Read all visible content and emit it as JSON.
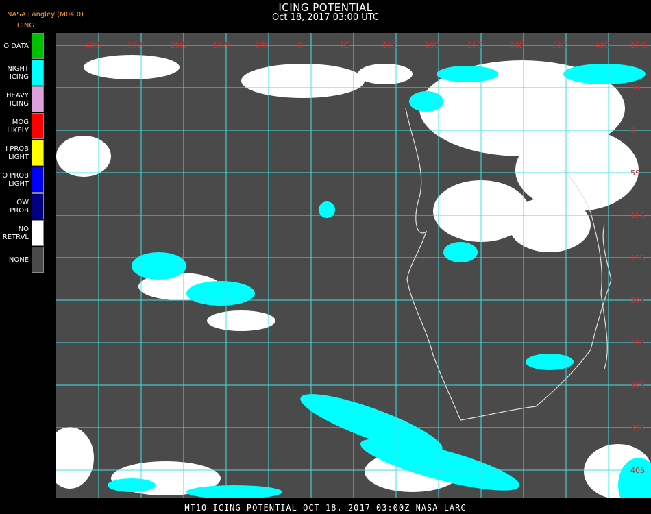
{
  "header": {
    "title": "ICING POTENTIAL",
    "subtitle": "Oct 18, 2017 03:00 UTC",
    "provider": "NASA Langley (M04.0)"
  },
  "legend": {
    "title": "ICING",
    "items": [
      {
        "lines": [
          "O DATA"
        ],
        "color": "#00c000"
      },
      {
        "lines": [
          "NIGHT",
          "ICING"
        ],
        "color": "#00ffff"
      },
      {
        "lines": [
          "HEAVY",
          "ICING"
        ],
        "color": "#dda0dd"
      },
      {
        "lines": [
          "MOG",
          "LIKELY"
        ],
        "color": "#ff0000"
      },
      {
        "lines": [
          "I PROB",
          "LIGHT"
        ],
        "color": "#ffff00"
      },
      {
        "lines": [
          "O PROB",
          "LIGHT"
        ],
        "color": "#0000ff"
      },
      {
        "lines": [
          "LOW",
          "PROB"
        ],
        "color": "#000080"
      },
      {
        "lines": [
          "NO",
          "RETRVL"
        ],
        "color": "#ffffff"
      },
      {
        "lines": [
          "NONE"
        ],
        "color": "#4a4a4a"
      }
    ]
  },
  "map": {
    "background": "#4a4a4a",
    "grid_color": "#40e0e8",
    "label_color": "#c03030",
    "coast_color": "#e0e0e0",
    "lon_labels": [
      "40W",
      "30W",
      "20W",
      "10W",
      "5W",
      "0",
      "5E",
      "10E",
      "20E",
      "25E",
      "30E",
      "35E",
      "40E"
    ],
    "lat_labels": [
      "15N",
      "5N",
      "0",
      "5S",
      "10S",
      "15S",
      "20S",
      "25S",
      "30S",
      "35S",
      "40S",
      "45S"
    ]
  },
  "footer": "MT10   ICING POTENTIAL   OCT 18, 2017 03:00Z   NASA LARC"
}
